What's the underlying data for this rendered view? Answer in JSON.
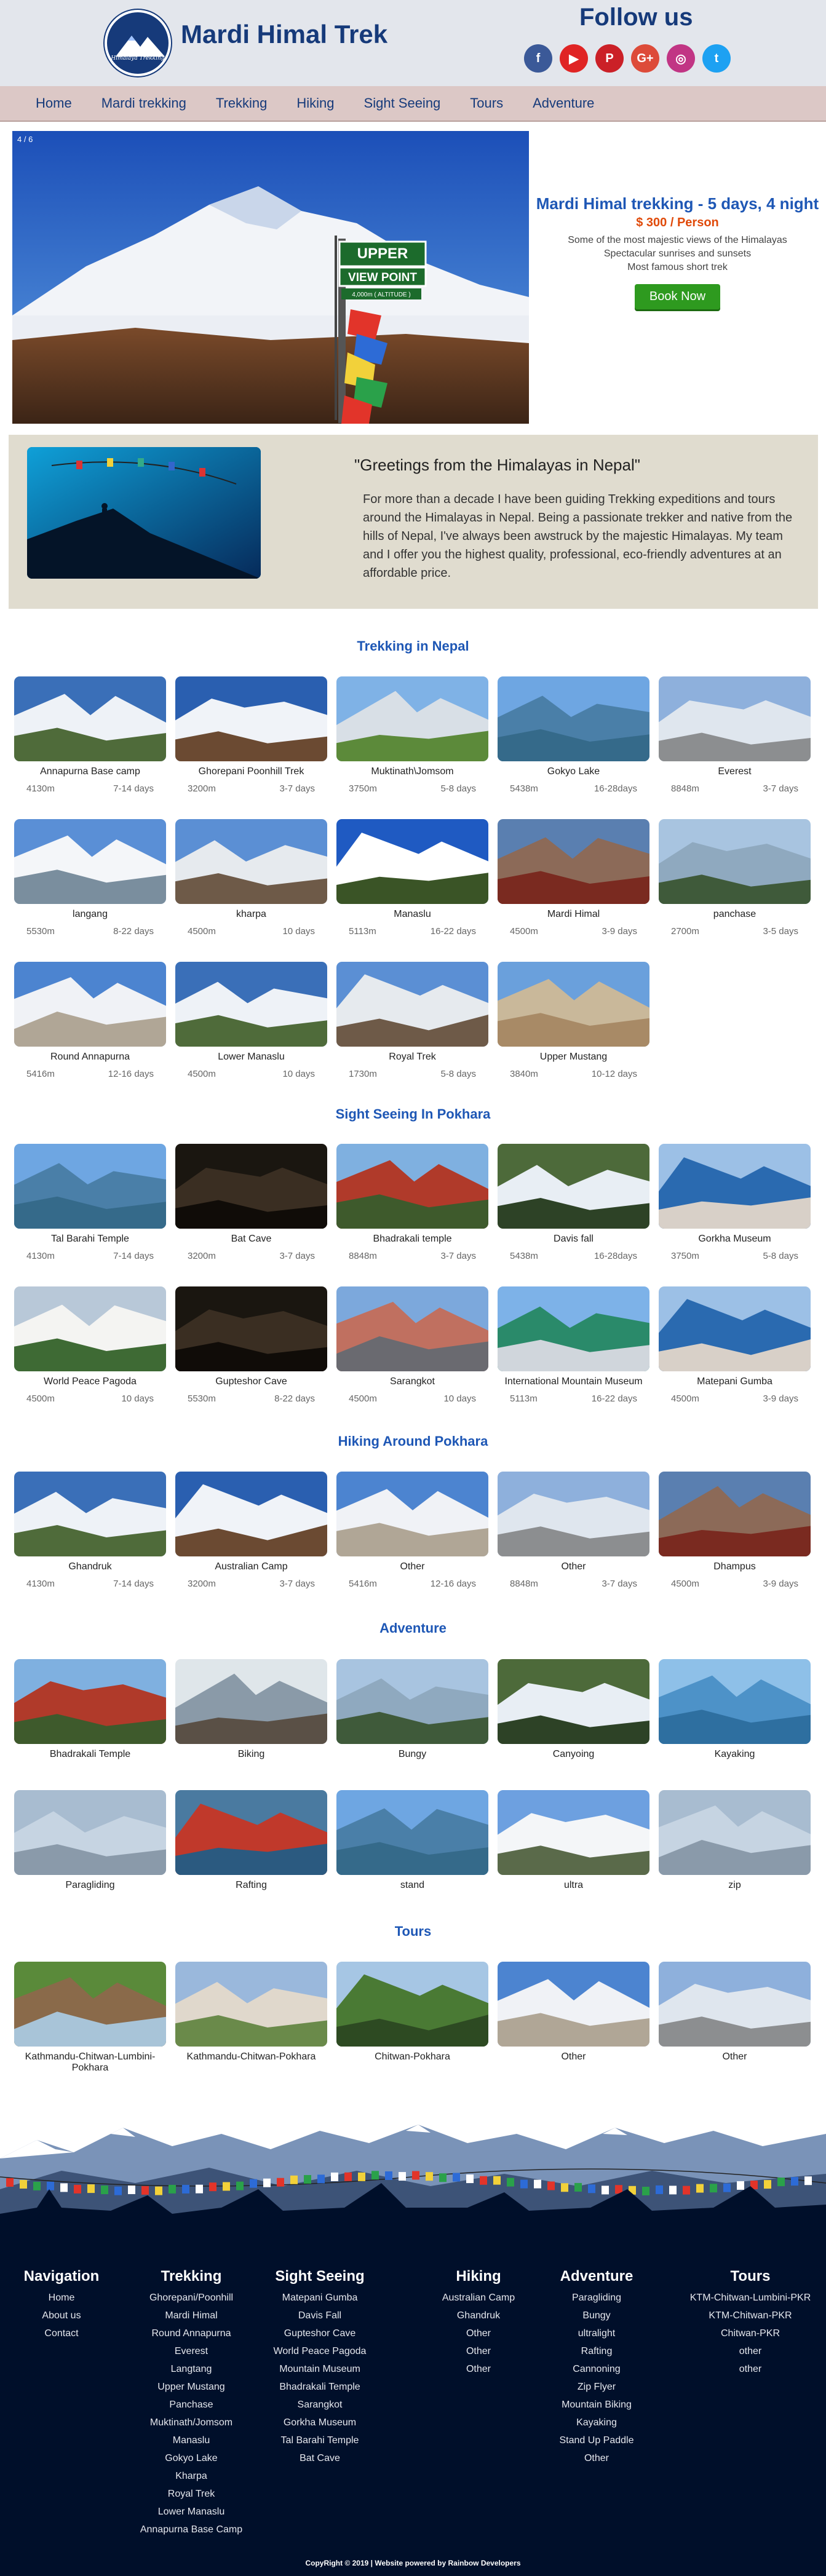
{
  "header": {
    "site_title": "Mardi Himal Trek",
    "follow_us": "Follow us",
    "logo_caption": "Himalaya Trekking",
    "social": [
      {
        "icon": "facebook-icon",
        "glyph": "f",
        "color": "#3b5998"
      },
      {
        "icon": "youtube-icon",
        "glyph": "▶",
        "color": "#e02424"
      },
      {
        "icon": "pinterest-icon",
        "glyph": "P",
        "color": "#cb2027"
      },
      {
        "icon": "google-plus-icon",
        "glyph": "G+",
        "color": "#dd4b39"
      },
      {
        "icon": "instagram-icon",
        "glyph": "◎",
        "color": "#c13584"
      },
      {
        "icon": "twitter-icon",
        "glyph": "t",
        "color": "#1da1f2"
      }
    ]
  },
  "nav": [
    "Home",
    "Mardi trekking",
    "Trekking",
    "Hiking",
    "Sight Seeing",
    "Tours",
    "Adventure"
  ],
  "hero": {
    "counter": "4 / 6",
    "title": "Mardi Himal trekking - 5 days, 4 night",
    "price": "$ 300 / Person",
    "lines": [
      "Some of the most majestic views of the Himalayas",
      "Spectacular sunrises and sunsets",
      "Most famous short trek"
    ],
    "button": "Book Now",
    "sign_line1": "UPPER",
    "sign_line2": "VIEW POINT",
    "sign_line3": "4,000m ( ALTITUDE )"
  },
  "greeting": {
    "title": "\"Greetings from the Himalayas in Nepal\"",
    "body": "For more than a decade I have been guiding Trekking expeditions and tours around the Himalayas in Nepal. Being a passionate trekker and native from the hills of Nepal, I've always been awstruck by the majestic Himalayas. My team and I offer you the highest quality, professional, eco-friendly adventures at an affordable price."
  },
  "sections": {
    "trekking": {
      "title": "Trekking in Nepal",
      "items": [
        {
          "name": "Annapurna Base camp",
          "alt": "4130m",
          "days": "7-14 days",
          "theme": "mountain"
        },
        {
          "name": "Ghorepani Poonhill Trek",
          "alt": "3200m",
          "days": "3-7 days",
          "theme": "sign"
        },
        {
          "name": "Muktinath\\Jomsom",
          "alt": "3750m",
          "days": "5-8 days",
          "theme": "valley"
        },
        {
          "name": "Gokyo Lake",
          "alt": "5438m",
          "days": "16-28days",
          "theme": "lake"
        },
        {
          "name": "Everest",
          "alt": "8848m",
          "days": "3-7 days",
          "theme": "glacier"
        },
        {
          "name": "langang",
          "alt": "5530m",
          "days": "8-22 days",
          "theme": "snow"
        },
        {
          "name": "kharpa",
          "alt": "4500m",
          "days": "10 days",
          "theme": "village"
        },
        {
          "name": "Manaslu",
          "alt": "5113m",
          "days": "16-22 days",
          "theme": "peak"
        },
        {
          "name": "Mardi Himal",
          "alt": "4500m",
          "days": "3-9 days",
          "theme": "red"
        },
        {
          "name": "panchase",
          "alt": "2700m",
          "days": "3-5 days",
          "theme": "forest"
        },
        {
          "name": "Round Annapurna",
          "alt": "5416m",
          "days": "12-16 days",
          "theme": "flags"
        },
        {
          "name": "Lower Manaslu",
          "alt": "4500m",
          "days": "10 days",
          "theme": "mountain"
        },
        {
          "name": "Royal Trek",
          "alt": "1730m",
          "days": "5-8 days",
          "theme": "village"
        },
        {
          "name": "Upper Mustang",
          "alt": "3840m",
          "days": "10-12 days",
          "theme": "desert"
        }
      ]
    },
    "sightseeing": {
      "title": "Sight Seeing In Pokhara",
      "items": [
        {
          "name": "Tal Barahi Temple",
          "alt": "4130m",
          "days": "7-14 days",
          "theme": "lake"
        },
        {
          "name": "Bat Cave",
          "alt": "3200m",
          "days": "3-7 days",
          "theme": "cave"
        },
        {
          "name": "Bhadrakali temple",
          "alt": "8848m",
          "days": "3-7 days",
          "theme": "temple"
        },
        {
          "name": "Davis fall",
          "alt": "5438m",
          "days": "16-28days",
          "theme": "waterfall"
        },
        {
          "name": "Gorkha Museum",
          "alt": "3750m",
          "days": "5-8 days",
          "theme": "building"
        },
        {
          "name": "World Peace Pagoda",
          "alt": "4500m",
          "days": "10 days",
          "theme": "pagoda"
        },
        {
          "name": "Gupteshor Cave",
          "alt": "5530m",
          "days": "8-22 days",
          "theme": "cave"
        },
        {
          "name": "Sarangkot",
          "alt": "4500m",
          "days": "10 days",
          "theme": "crowd"
        },
        {
          "name": "International Mountain Museum",
          "alt": "5113m",
          "days": "16-22 days",
          "theme": "museum"
        },
        {
          "name": "Matepani Gumba",
          "alt": "4500m",
          "days": "3-9 days",
          "theme": "building"
        }
      ]
    },
    "hiking": {
      "title": "Hiking Around Pokhara",
      "items": [
        {
          "name": "Ghandruk",
          "alt": "4130m",
          "days": "7-14 days",
          "theme": "mountain"
        },
        {
          "name": "Australian Camp",
          "alt": "3200m",
          "days": "3-7 days",
          "theme": "sign"
        },
        {
          "name": "Other",
          "alt": "5416m",
          "days": "12-16 days",
          "theme": "flags"
        },
        {
          "name": "Other",
          "alt": "8848m",
          "days": "3-7 days",
          "theme": "glacier"
        },
        {
          "name": "Dhampus",
          "alt": "4500m",
          "days": "3-9 days",
          "theme": "red"
        }
      ]
    },
    "adventure": {
      "title": "Adventure",
      "items": [
        {
          "name": "Bhadrakali Temple",
          "theme": "temple"
        },
        {
          "name": "Biking",
          "theme": "bike"
        },
        {
          "name": "Bungy",
          "theme": "forest"
        },
        {
          "name": "Canyoing",
          "theme": "waterfall"
        },
        {
          "name": "Kayaking",
          "theme": "kayak"
        },
        {
          "name": "Paragliding",
          "theme": "sky"
        },
        {
          "name": "Rafting",
          "theme": "raft"
        },
        {
          "name": "stand",
          "theme": "lake"
        },
        {
          "name": "ultra",
          "theme": "plane"
        },
        {
          "name": "zip",
          "theme": "sky"
        }
      ]
    },
    "tours": {
      "title": "Tours",
      "items": [
        {
          "name": "Kathmandu-Chitwan-Lumbini-Pokhara",
          "theme": "collage"
        },
        {
          "name": "Kathmandu-Chitwan-Pokhara",
          "theme": "collage2"
        },
        {
          "name": "Chitwan-Pokhara",
          "theme": "jungle"
        },
        {
          "name": "Other",
          "theme": "flags"
        },
        {
          "name": "Other",
          "theme": "glacier"
        }
      ]
    }
  },
  "footer": {
    "columns": [
      {
        "title": "Navigation",
        "items": [
          "Home",
          "About us",
          "Contact"
        ]
      },
      {
        "title": "Trekking",
        "items": [
          "Ghorepani/Poonhill",
          "Mardi Himal",
          "Round Annapurna",
          "Everest",
          "Langtang",
          "Upper Mustang",
          "Panchase",
          "Muktinath/Jomsom",
          "Manaslu",
          "Gokyo Lake",
          "Kharpa",
          "Royal Trek",
          "Lower Manaslu",
          "Annapurna Base Camp"
        ]
      },
      {
        "title": "Sight Seeing",
        "items": [
          "Matepani Gumba",
          "Davis Fall",
          "Gupteshor Cave",
          "World Peace Pagoda",
          "Mountain Museum",
          "Bhadrakali Temple",
          "Sarangkot",
          "Gorkha Museum",
          "Tal Barahi Temple",
          "Bat Cave"
        ]
      },
      {
        "title": "Hiking",
        "items": [
          "Australian Camp",
          "Ghandruk",
          "Other",
          "Other",
          "Other"
        ]
      },
      {
        "title": "Adventure",
        "items": [
          "Paragliding",
          "Bungy",
          "ultralight",
          "Rafting",
          "Cannoning",
          "Zip Flyer",
          "Mountain Biking",
          "Kayaking",
          "Stand Up Paddle",
          "Other"
        ]
      },
      {
        "title": "Tours",
        "items": [
          "KTM-Chitwan-Lumbini-PKR",
          "KTM-Chitwan-PKR",
          "Chitwan-PKR",
          "other",
          "other"
        ]
      }
    ],
    "copyright": "CopyRight © 2019 | Website powered by Rainbow Developers"
  },
  "colors": {
    "brand": "#163a7a",
    "accent": "#1e57b5",
    "price": "#e04a0a",
    "book": "#2e9a1f",
    "footer_bg": "#000f2a"
  }
}
